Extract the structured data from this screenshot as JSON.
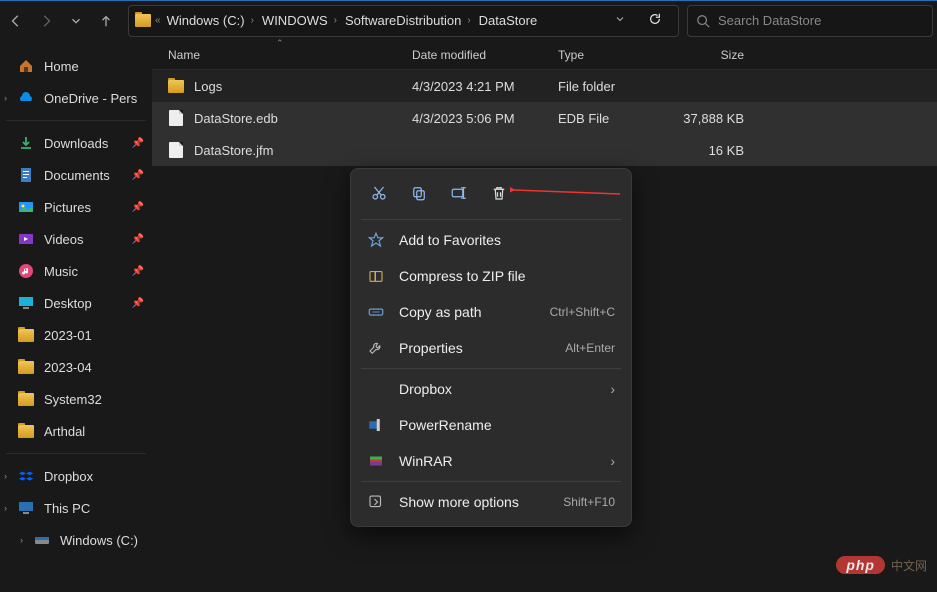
{
  "breadcrumb": [
    "Windows (C:)",
    "WINDOWS",
    "SoftwareDistribution",
    "DataStore"
  ],
  "search": {
    "placeholder": "Search DataStore"
  },
  "sidebar": {
    "top": [
      {
        "label": "Home",
        "icon": "home"
      },
      {
        "label": "OneDrive - Pers",
        "icon": "onedrive",
        "expandable": true
      }
    ],
    "quick": [
      {
        "label": "Downloads",
        "icon": "download",
        "pinned": true
      },
      {
        "label": "Documents",
        "icon": "document",
        "pinned": true
      },
      {
        "label": "Pictures",
        "icon": "pictures",
        "pinned": true
      },
      {
        "label": "Videos",
        "icon": "videos",
        "pinned": true
      },
      {
        "label": "Music",
        "icon": "music",
        "pinned": true
      },
      {
        "label": "Desktop",
        "icon": "desktop",
        "pinned": true
      },
      {
        "label": "2023-01",
        "icon": "folder"
      },
      {
        "label": "2023-04",
        "icon": "folder"
      },
      {
        "label": "System32",
        "icon": "folder"
      },
      {
        "label": "Arthdal",
        "icon": "folder"
      }
    ],
    "locations": [
      {
        "label": "Dropbox",
        "icon": "dropbox",
        "expandable": true
      },
      {
        "label": "This PC",
        "icon": "thispc",
        "expandable": true
      },
      {
        "label": "Windows (C:)",
        "icon": "drive",
        "expandable": true,
        "indent": true
      }
    ]
  },
  "columns": {
    "name": "Name",
    "date": "Date modified",
    "type": "Type",
    "size": "Size"
  },
  "files": [
    {
      "name": "Logs",
      "date": "4/3/2023 4:21 PM",
      "type": "File folder",
      "size": "",
      "icon": "folder",
      "cls": "striped"
    },
    {
      "name": "DataStore.edb",
      "date": "4/3/2023 5:06 PM",
      "type": "EDB File",
      "size": "37,888 KB",
      "icon": "file",
      "cls": "sel"
    },
    {
      "name": "DataStore.jfm",
      "date": "",
      "type": "",
      "size": "16 KB",
      "icon": "file",
      "cls": "sel"
    }
  ],
  "ctx": {
    "items": [
      {
        "label": "Add to Favorites",
        "icon": "star"
      },
      {
        "label": "Compress to ZIP file",
        "icon": "zip"
      },
      {
        "label": "Copy as path",
        "icon": "path",
        "kbd": "Ctrl+Shift+C"
      },
      {
        "label": "Properties",
        "icon": "wrench",
        "kbd": "Alt+Enter"
      }
    ],
    "apps": [
      {
        "label": "Dropbox",
        "icon": "none",
        "sub": true
      },
      {
        "label": "PowerRename",
        "icon": "powerrename"
      },
      {
        "label": "WinRAR",
        "icon": "winrar",
        "sub": true
      }
    ],
    "more": {
      "label": "Show more options",
      "kbd": "Shift+F10"
    }
  },
  "watermark": {
    "badge": "php",
    "text": "中文网"
  }
}
